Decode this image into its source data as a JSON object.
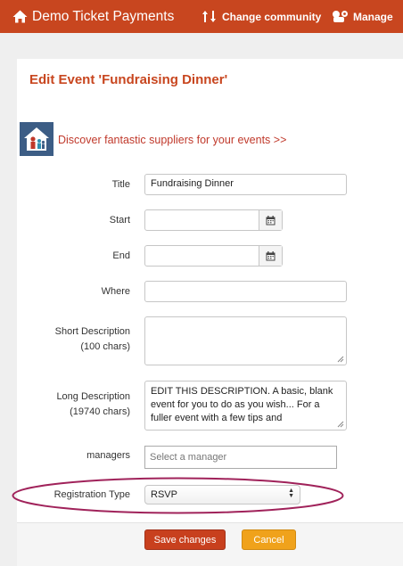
{
  "nav": {
    "brand": "Demo Ticket Payments",
    "change_community": "Change community",
    "manage": "Manage"
  },
  "heading": "Edit Event 'Fundraising Dinner'",
  "promo": {
    "text": "Discover fantastic suppliers for your events >>"
  },
  "form": {
    "title": {
      "label": "Title",
      "value": "Fundraising Dinner"
    },
    "start": {
      "label": "Start",
      "value": ""
    },
    "end": {
      "label": "End",
      "value": ""
    },
    "where": {
      "label": "Where",
      "value": ""
    },
    "short_description": {
      "label": "Short Description",
      "sublabel": "(100 chars)",
      "value": ""
    },
    "long_description": {
      "label": "Long Description",
      "sublabel": "(19740 chars)",
      "value": "EDIT THIS DESCRIPTION. A basic, blank event for you to do as you wish... For a fuller event with a few tips and"
    },
    "managers": {
      "label": "managers",
      "placeholder": "Select a manager"
    },
    "registration_type": {
      "label": "Registration Type",
      "value": "RSVP"
    }
  },
  "actions": {
    "save": "Save changes",
    "cancel": "Cancel"
  },
  "colors": {
    "nav_bg": "#c8461f",
    "heading": "#c8461f",
    "promo_text": "#c0392b",
    "save_bg": "#c8401e",
    "cancel_bg": "#f0a21b",
    "annotation": "#a0225a"
  }
}
